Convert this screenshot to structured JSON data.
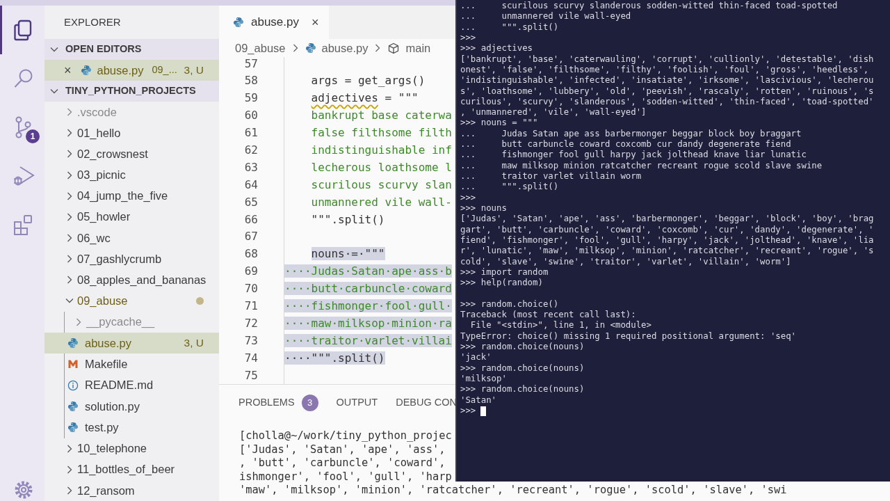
{
  "activity_bar": {
    "items": [
      {
        "kind": "explorer",
        "selected": true
      },
      {
        "kind": "search",
        "selected": false
      },
      {
        "kind": "source-control",
        "selected": false,
        "badge": "1"
      },
      {
        "kind": "debug",
        "selected": false
      },
      {
        "kind": "extensions",
        "selected": false
      },
      {
        "kind": "settings",
        "selected": false
      }
    ]
  },
  "sidebar": {
    "title": "EXPLORER",
    "sections": [
      {
        "title": "OPEN EDITORS",
        "expanded": true,
        "items": [
          {
            "kind": "python",
            "close": "×",
            "label": "abuse.py",
            "description": "09_...",
            "status": "3, U",
            "selected": true
          }
        ]
      },
      {
        "title": "TINY_PYTHON_PROJECTS",
        "expanded": true,
        "items": [
          {
            "kind": "folder",
            "label": ".vscode",
            "expanded": false,
            "selected": false,
            "dimmed": true,
            "modified": false
          },
          {
            "kind": "folder",
            "label": "01_hello",
            "expanded": false,
            "selected": false,
            "dimmed": false,
            "modified": false
          },
          {
            "kind": "folder",
            "label": "02_crowsnest",
            "expanded": false,
            "selected": false,
            "dimmed": false,
            "modified": false
          },
          {
            "kind": "folder",
            "label": "03_picnic",
            "expanded": false,
            "selected": false,
            "dimmed": false,
            "modified": false
          },
          {
            "kind": "folder",
            "label": "04_jump_the_five",
            "expanded": false,
            "selected": false,
            "dimmed": false,
            "modified": false
          },
          {
            "kind": "folder",
            "label": "05_howler",
            "expanded": false,
            "selected": false,
            "dimmed": false,
            "modified": false
          },
          {
            "kind": "folder",
            "label": "06_wc",
            "expanded": false,
            "selected": false,
            "dimmed": false,
            "modified": false
          },
          {
            "kind": "folder",
            "label": "07_gashlycrumb",
            "expanded": false,
            "selected": false,
            "dimmed": false,
            "modified": false
          },
          {
            "kind": "folder",
            "label": "08_apples_and_bananas",
            "expanded": false,
            "selected": false,
            "dimmed": false,
            "modified": false
          },
          {
            "kind": "folder",
            "label": "09_abuse",
            "expanded": true,
            "selected": false,
            "dimmed": false,
            "modified": true,
            "children": [
              {
                "kind": "folder",
                "label": "__pycache__",
                "expanded": false,
                "selected": false,
                "dimmed": true,
                "modified": false
              },
              {
                "kind": "python",
                "label": "abuse.py",
                "status": "3, U",
                "selected": true,
                "dimmed": false
              },
              {
                "kind": "makefile",
                "label": "Makefile",
                "selected": false,
                "dimmed": false
              },
              {
                "kind": "readme",
                "label": "README.md",
                "selected": false,
                "dimmed": false
              },
              {
                "kind": "python",
                "label": "solution.py",
                "selected": false,
                "dimmed": false
              },
              {
                "kind": "python",
                "label": "test.py",
                "selected": false,
                "dimmed": false
              }
            ]
          },
          {
            "kind": "folder",
            "label": "10_telephone",
            "expanded": false,
            "selected": false,
            "dimmed": false,
            "modified": false
          },
          {
            "kind": "folder",
            "label": "11_bottles_of_beer",
            "expanded": false,
            "selected": false,
            "dimmed": false,
            "modified": false
          },
          {
            "kind": "folder",
            "label": "12_ransom",
            "expanded": false,
            "selected": false,
            "dimmed": false,
            "modified": false
          }
        ]
      }
    ]
  },
  "editor": {
    "tab": {
      "kind": "python",
      "label": "abuse.py",
      "close": "×"
    },
    "breadcrumbs": [
      {
        "kind": "folder",
        "label": "09_abuse"
      },
      {
        "kind": "python",
        "label": "abuse.py"
      },
      {
        "kind": "function",
        "label": "main"
      }
    ],
    "lines": [
      {
        "number": "57",
        "kind": "code",
        "selected": false
      },
      {
        "number": "58",
        "kind": "code",
        "selected": false,
        "text": "    args = get_args()"
      },
      {
        "number": "59",
        "kind": "code",
        "selected": false,
        "segments": [
          {
            "text": "    adjectives",
            "warning": true
          },
          {
            "text": " = \"\"\"",
            "warning": false
          }
        ]
      },
      {
        "number": "60",
        "kind": "string",
        "selected": false,
        "text": "    bankrupt base caterwa"
      },
      {
        "number": "61",
        "kind": "string",
        "selected": false,
        "text": "    false filthsome filth"
      },
      {
        "number": "62",
        "kind": "string",
        "selected": false,
        "text": "    indistinguishable inf"
      },
      {
        "number": "63",
        "kind": "string",
        "selected": false,
        "text": "    lecherous loathsome l"
      },
      {
        "number": "64",
        "kind": "string",
        "selected": false,
        "text": "    scurilous scurvy slan"
      },
      {
        "number": "65",
        "kind": "string",
        "selected": false,
        "text": "    unmannered vile wall-"
      },
      {
        "number": "66",
        "kind": "code",
        "selected": false,
        "text": "    \"\"\".split()"
      },
      {
        "number": "67",
        "kind": "code",
        "selected": false
      },
      {
        "number": "68",
        "kind": "code",
        "selected": true,
        "text": "    nouns·=·\"\"\""
      },
      {
        "number": "69",
        "kind": "string",
        "selected": true,
        "text": "····Judas·Satan·ape·ass·b"
      },
      {
        "number": "70",
        "kind": "string",
        "selected": true,
        "text": "····butt·carbuncle·coward"
      },
      {
        "number": "71",
        "kind": "string",
        "selected": true,
        "text": "····fishmonger·fool·gull·"
      },
      {
        "number": "72",
        "kind": "string",
        "selected": true,
        "text": "····maw·milksop·minion·ra"
      },
      {
        "number": "73",
        "kind": "string",
        "selected": true,
        "text": "····traitor·varlet·villai"
      },
      {
        "number": "74",
        "kind": "code",
        "selected": true,
        "text": "····\"\"\".split()"
      },
      {
        "number": "75",
        "kind": "code",
        "selected": false
      }
    ]
  },
  "panel": {
    "tabs": [
      {
        "label": "PROBLEMS",
        "badge": "3"
      },
      {
        "label": "OUTPUT"
      },
      {
        "label": "DEBUG CON"
      }
    ],
    "lines": [
      "[cholla@~/work/tiny_python_projec",
      "['Judas', 'Satan', 'ape', 'ass',",
      ", 'butt', 'carbuncle', 'coward',",
      "ishmonger', 'fool', 'gull', 'harp",
      "'maw', 'milksop', 'minion', 'ratcatcher', 'recreant', 'rogue', 'scold', 'slave', 'swi"
    ]
  },
  "repl": {
    "blocks": [
      [
        "...     scurilous scurvy slanderous sodden-witted thin-faced toad-spotted",
        "...     unmannered vile wall-eyed",
        "...     \"\"\".split()",
        ">>>",
        ">>> adjectives",
        "['bankrupt', 'base', 'caterwauling', 'corrupt', 'cullionly', 'detestable', 'dish",
        "onest', 'false', 'filthsome', 'filthy', 'foolish', 'foul', 'gross', 'heedless',",
        "'indistinguishable', 'infected', 'insatiate', 'irksome', 'lascivious', 'lecherou",
        "s', 'loathsome', 'lubbery', 'old', 'peevish', 'rascaly', 'rotten', 'ruinous', 's",
        "curilous', 'scurvy', 'slanderous', 'sodden-witted', 'thin-faced', 'toad-spotted'",
        ", 'unmannered', 'vile', 'wall-eyed']",
        ">>> nouns = \"\"\"",
        "...     Judas Satan ape ass barbermonger beggar block boy braggart",
        "...     butt carbuncle coward coxcomb cur dandy degenerate fiend",
        "...     fishmonger fool gull harpy jack jolthead knave liar lunatic",
        "...     maw milksop minion ratcatcher recreant rogue scold slave swine",
        "...     traitor varlet villain worm",
        "...     \"\"\".split()",
        ">>>",
        ">>> nouns",
        "['Judas', 'Satan', 'ape', 'ass', 'barbermonger', 'beggar', 'block', 'boy', 'brag",
        "gart', 'butt', 'carbuncle', 'coward', 'coxcomb', 'cur', 'dandy', 'degenerate', '",
        "fiend', 'fishmonger', 'fool', 'gull', 'harpy', 'jack', 'jolthead', 'knave', 'lia",
        "r', 'lunatic', 'maw', 'milksop', 'minion', 'ratcatcher', 'recreant', 'rogue', 's",
        "cold', 'slave', 'swine', 'traitor', 'varlet', 'villain', 'worm']",
        ">>> import random",
        ">>> help(random)"
      ],
      [
        ">>> random.choice()",
        "Traceback (most recent call last):",
        "  File \"<stdin>\", line 1, in <module>",
        "TypeError: choice() missing 1 required positional argument: 'seq'",
        ">>> random.choice(nouns)",
        "'jack'",
        ">>> random.choice(nouns)",
        "'milksop'",
        ">>> random.choice(nouns)",
        "'Satan'"
      ]
    ],
    "prompt": ">>>"
  }
}
